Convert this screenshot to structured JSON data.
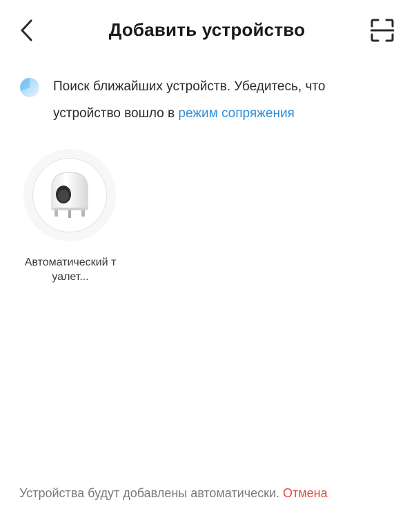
{
  "header": {
    "back_icon": "chevron-left-icon",
    "title": "Добавить устройство",
    "scan_icon": "scan-frame-icon"
  },
  "search": {
    "status_icon": "searching-spinner-icon",
    "text_part1": "Поиск ближайших устройств. Убедитесь, что устройство вошло в ",
    "link_text": "режим сопряжения",
    "link_color": "#2f8fd8"
  },
  "devices": [
    {
      "name": "Автоматический туалет...",
      "icon": "litter-box-icon"
    }
  ],
  "footer": {
    "text": "Устройства будут добавлены автоматически. ",
    "cancel_label": "Отмена",
    "cancel_color": "#e04b44"
  }
}
